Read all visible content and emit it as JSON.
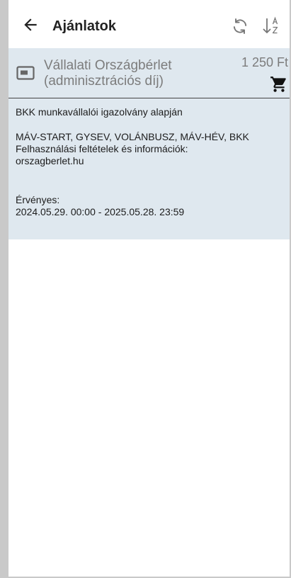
{
  "header": {
    "title": "Ajánlatok"
  },
  "offer": {
    "name": "Vállalati Országbérlet (adminisztrációs díj)",
    "price": "1 250 Ft",
    "eligibility": "BKK munkavállalói igazolvány alapján",
    "operators": "MÁV-START, GYSEV, VOLÁNBUSZ, MÁV-HÉV, BKK",
    "terms_label": "Felhasználási feltételek és információk:",
    "terms_link": "orszagberlet.hu",
    "validity_label": "Érvényes:",
    "validity_range": "2024.05.29. 00:00 - 2025.05.28. 23:59"
  },
  "icons": {
    "back": "arrow-left-icon",
    "refresh": "refresh-icon",
    "sort": "sort-az-icon",
    "ticket": "ticket-card-icon",
    "cart": "shopping-cart-icon"
  },
  "colors": {
    "card_background": "#dfe8ef",
    "frame": "#c9c9c9",
    "muted_text": "#7c7c7c"
  }
}
